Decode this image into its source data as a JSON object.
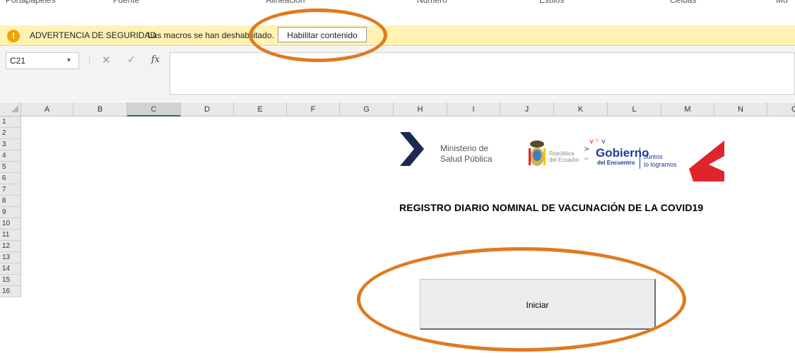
{
  "ribbon": {
    "groups": [
      "Portapapeles",
      "Fuente",
      "Alineación",
      "Número",
      "Estilos",
      "Celdas",
      "Mo"
    ]
  },
  "security_bar": {
    "title": "ADVERTENCIA DE SEGURIDAD",
    "message": "Las macros se han deshabilitado.",
    "button_label": "Habilitar contenido",
    "icon": "warning-icon",
    "icon_glyph": "!",
    "background_color": "#fff2b2"
  },
  "formula_bar": {
    "name_box": "C21",
    "cancel_glyph": "✕",
    "enter_glyph": "✓",
    "fx_label": "fx",
    "value": ""
  },
  "grid": {
    "columns": [
      "A",
      "B",
      "C",
      "D",
      "E",
      "F",
      "G",
      "H",
      "I",
      "J",
      "K",
      "L",
      "M",
      "N",
      "O"
    ],
    "rows": [
      "1",
      "2",
      "3",
      "4",
      "5",
      "6",
      "7",
      "8",
      "9",
      "10",
      "11",
      "12",
      "13",
      "14",
      "15",
      "16"
    ],
    "selected_column": "C"
  },
  "banner": {
    "ministry_line1": "Ministerio de",
    "ministry_line2": "Salud Pública",
    "republic_line1": "República",
    "republic_line2": "del Ecuador",
    "gobierno": "Gobierno",
    "encuentro": "del Encuentro",
    "juntos_line1": "Juntos",
    "juntos_line2": "lo logramos",
    "brand_color": "#1f3a93",
    "accent_color": "#e0242b"
  },
  "sheet": {
    "title": "REGISTRO DIARIO NOMINAL DE VACUNACIÓN DE LA COVID19",
    "start_button": "Iniciar"
  },
  "annotation_color": "#e07a1f"
}
